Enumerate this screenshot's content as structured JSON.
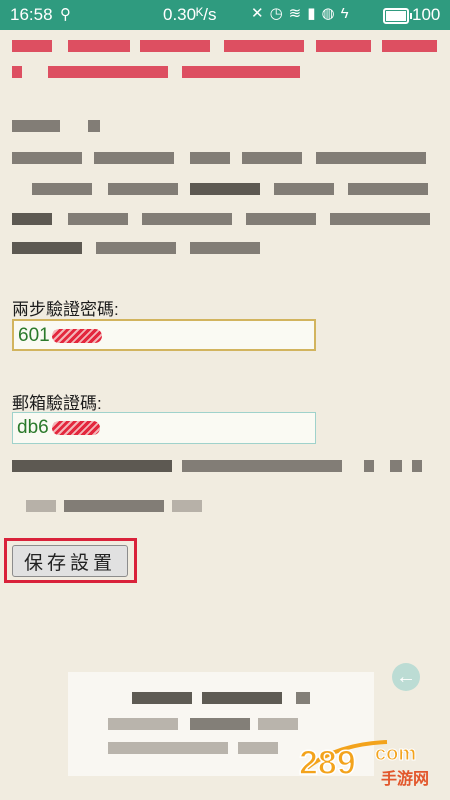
{
  "status_bar": {
    "time": "16:58",
    "network_speed": "0.30ᴷ/s",
    "battery_percent": "100"
  },
  "form": {
    "two_step_label": "兩步驗證密碼:",
    "two_step_value": "601",
    "email_code_label": "郵箱驗證碼:",
    "email_code_value": "db6"
  },
  "save_button_label": "保存設置",
  "watermark": {
    "brand": "289",
    "suffix": "com",
    "subtitle": "手游网"
  },
  "colors": {
    "status_bar": "#2f9b7f",
    "page_background": "#f1ece0",
    "highlight": "#d9223a",
    "field_text": "#2b7a2b"
  }
}
